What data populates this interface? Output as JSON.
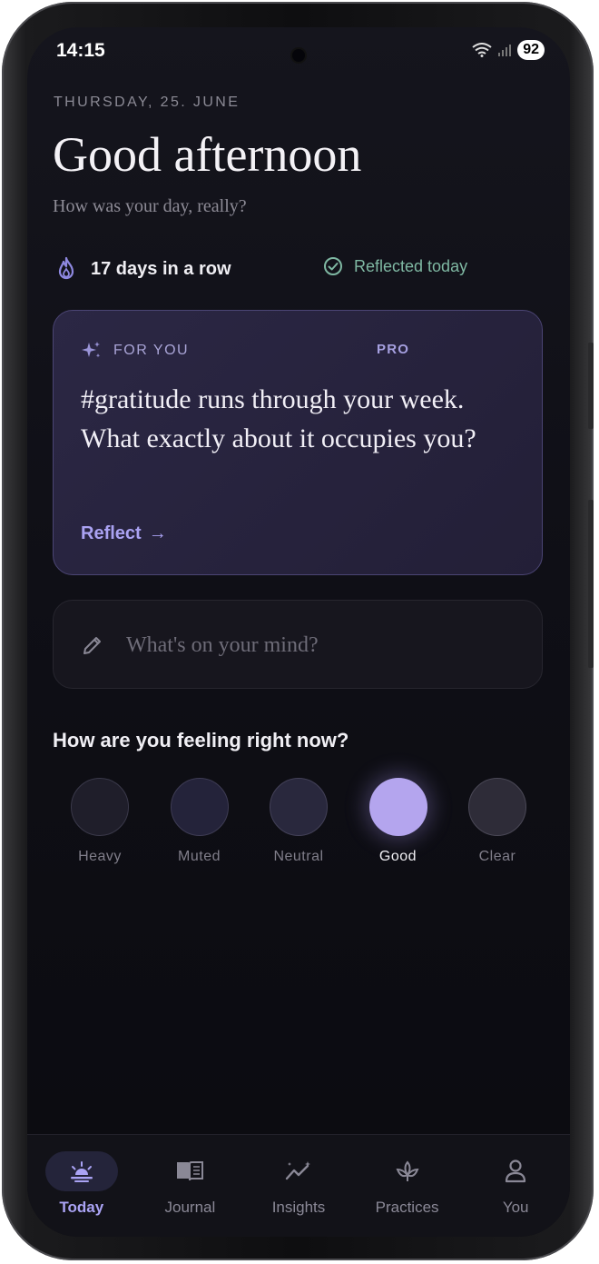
{
  "status": {
    "time": "14:15",
    "battery": "92"
  },
  "header": {
    "date": "THURSDAY, 25. JUNE",
    "greeting": "Good afternoon",
    "subtitle": "How was your day, really?"
  },
  "streak": {
    "label": "17 days in a row",
    "icon": "flame-icon"
  },
  "reflected": {
    "label": "Reflected today",
    "icon": "check-circle-icon",
    "color": "#7fb8a3"
  },
  "card": {
    "eyebrow": "FOR YOU",
    "badge": "PRO",
    "prompt": "#gratitude runs through your week. What exactly about it occupies you?",
    "action": "Reflect",
    "action_arrow": "→"
  },
  "entry": {
    "placeholder": "What's on your mind?",
    "icon": "pencil-icon"
  },
  "mood": {
    "question": "How are you feeling right now?",
    "options": [
      {
        "label": "Heavy",
        "color": "#1f1e2a"
      },
      {
        "label": "Muted",
        "color": "#24233a"
      },
      {
        "label": "Neutral",
        "color": "#29283d"
      },
      {
        "label": "Good",
        "color": "#b4a5ee"
      },
      {
        "label": "Clear",
        "color": "#2e2c38"
      }
    ],
    "selected": "Good"
  },
  "tabs": [
    {
      "label": "Today",
      "icon": "sunrise-icon",
      "active": true
    },
    {
      "label": "Journal",
      "icon": "book-icon",
      "active": false
    },
    {
      "label": "Insights",
      "icon": "trend-sparkle-icon",
      "active": false
    },
    {
      "label": "Practices",
      "icon": "lotus-icon",
      "active": false
    },
    {
      "label": "You",
      "icon": "person-icon",
      "active": false
    }
  ],
  "colors": {
    "accent": "#aaa3f4",
    "background": "#0f0f16"
  }
}
